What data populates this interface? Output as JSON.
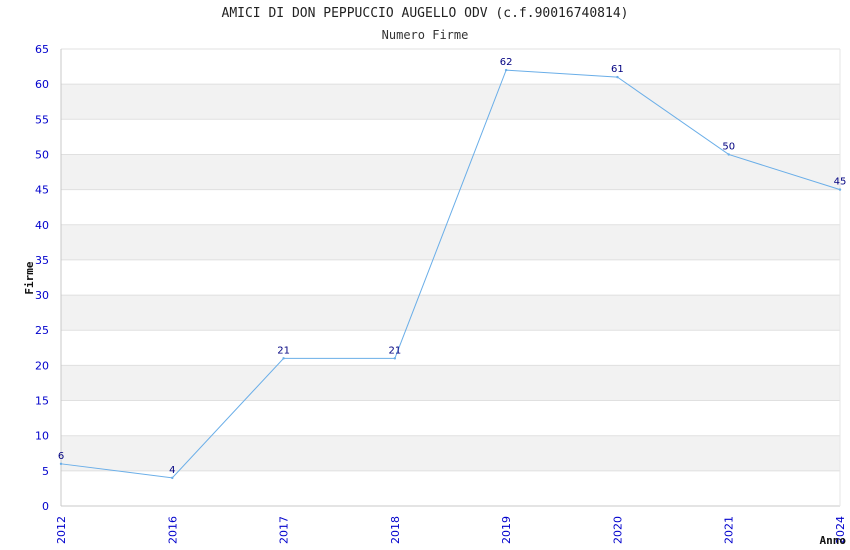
{
  "chart_data": {
    "type": "line",
    "title": "AMICI DI DON PEPPUCCIO AUGELLO ODV (c.f.90016740814)",
    "subtitle": "Numero Firme",
    "xlabel": "Anno",
    "ylabel": "Firme",
    "categories": [
      "2012",
      "2016",
      "2017",
      "2018",
      "2019",
      "2020",
      "2021",
      "2024"
    ],
    "series": [
      {
        "values": [
          6,
          4,
          21,
          21,
          62,
          61,
          50,
          45
        ]
      }
    ],
    "ylim": [
      0,
      65
    ],
    "yticks": [
      0,
      5,
      10,
      15,
      20,
      25,
      30,
      35,
      40,
      45,
      50,
      55,
      60,
      65
    ],
    "grid": true,
    "line_color": "#6aaee8",
    "tick_color": "#0000cc",
    "band_color": "#f2f2f2"
  }
}
